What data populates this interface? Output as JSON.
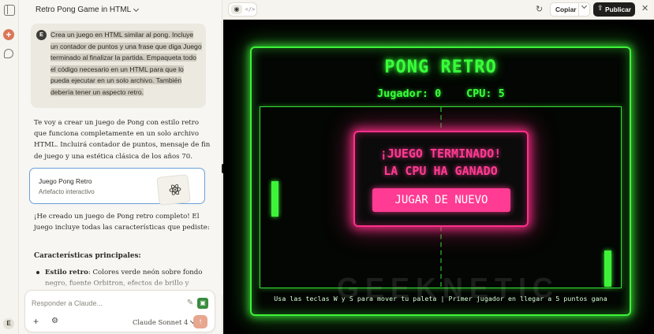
{
  "conversation": {
    "title": "Retro Pong Game in HTML",
    "user_avatar": "E",
    "user_message": "Crea un juego en HTML similar al pong. Incluye un contador de puntos y una frase que diga Juego terminado al finalizar la partida. Empaqueta todo el código necesario en un HTML para que lo pueda ejecutar en un solo archivo. También debería tener un aspecto retro.",
    "assistant_intro": "Te voy a crear un juego de Pong con estilo retro que funciona completamente en un solo archivo HTML. Incluirá contador de puntos, mensaje de fin de juego y una estética clásica de los años 70.",
    "artifact_title": "Juego Pong Retro",
    "artifact_subtitle": "Artefacto interactivo",
    "assistant_followup": "¡He creado un juego de Pong retro completo! El juego incluye todas las características que pediste:",
    "features_heading": "Características principales:",
    "feature1_bold": "Estilo retro",
    "feature1_text": ": Colores verde neón sobre fondo negro, fuente Orbitron, efectos de brillo y"
  },
  "composer": {
    "placeholder": "Responder a Claude...",
    "model": "Claude Sonnet 4"
  },
  "sidebar": {
    "avatar": "E"
  },
  "artifact_header": {
    "copy_label": "Copiar",
    "publish_label": "Publicar"
  },
  "game": {
    "title": "PONG RETRO",
    "player_score": "Jugador: 0",
    "cpu_score": "CPU: 5",
    "game_over_line1": "¡JUEGO TERMINADO!",
    "game_over_line2": "LA CPU HA GANADO",
    "play_again_label": "JUGAR DE NUEVO",
    "instructions": "Usa las teclas W y S para mover tu paleta | Primer jugador en llegar a 5 puntos gana",
    "neon_green": "#3ef23a",
    "neon_pink": "#ff3b93"
  },
  "watermark": "GEEKNETIC"
}
